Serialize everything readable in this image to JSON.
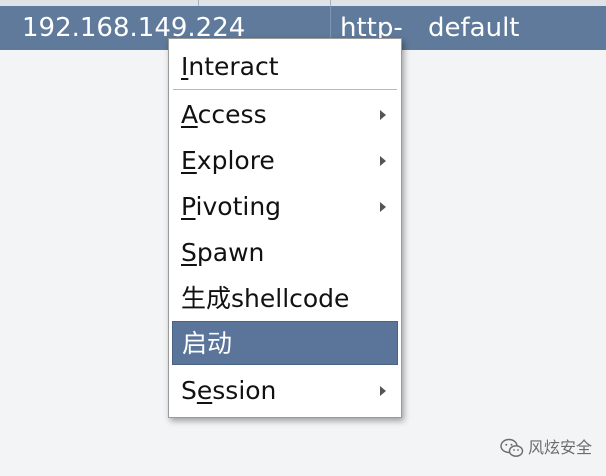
{
  "table": {
    "selected_row": {
      "address": "192.168.149.224",
      "listener": "http-",
      "profile": "default"
    }
  },
  "context_menu": {
    "items": [
      {
        "mnemonic": "I",
        "rest": "nteract",
        "has_submenu": false
      },
      {
        "mnemonic": "A",
        "rest": "ccess",
        "has_submenu": true
      },
      {
        "mnemonic": "E",
        "rest": "xplore",
        "has_submenu": true
      },
      {
        "mnemonic": "P",
        "rest": "ivoting",
        "has_submenu": true
      },
      {
        "mnemonic": "S",
        "rest": "pawn",
        "has_submenu": false
      },
      {
        "label": "生成shellcode",
        "has_submenu": false
      },
      {
        "label": "启动",
        "has_submenu": false,
        "highlighted": true
      },
      {
        "prefix": "S",
        "mnemonic": "e",
        "rest": "ssion",
        "has_submenu": true
      }
    ]
  },
  "watermark": {
    "icon": "wechat-icon",
    "text": "风炫安全"
  },
  "colors": {
    "selection_bg": "#5f7a9b",
    "menu_highlight_bg": "#5a7599",
    "menu_bg": "#ffffff"
  }
}
